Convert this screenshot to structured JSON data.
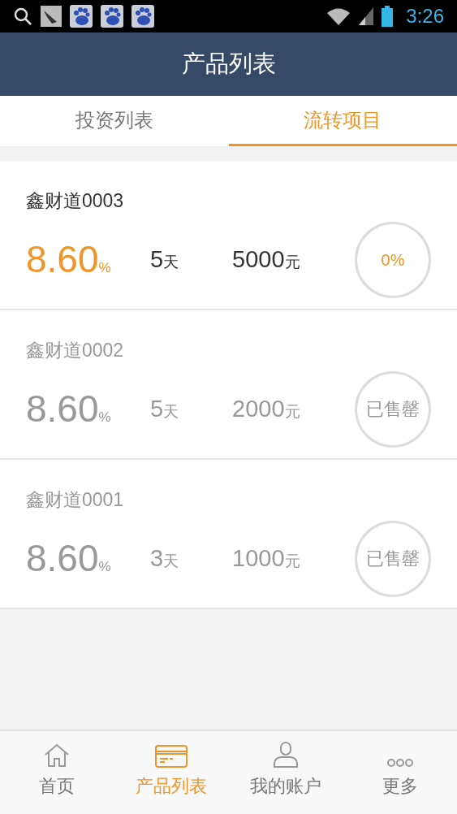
{
  "status_bar": {
    "time": "3:26"
  },
  "header": {
    "title": "产品列表"
  },
  "tabs": [
    {
      "label": "投资列表",
      "selected": false
    },
    {
      "label": "流转项目",
      "selected": true
    }
  ],
  "products": [
    {
      "name": "鑫财道0003",
      "rate": "8.60",
      "rate_unit": "%",
      "days": "5",
      "days_unit": "天",
      "amount": "5000",
      "amount_unit": "元",
      "badge": "0%",
      "sold_out": false
    },
    {
      "name": "鑫财道0002",
      "rate": "8.60",
      "rate_unit": "%",
      "days": "5",
      "days_unit": "天",
      "amount": "2000",
      "amount_unit": "元",
      "badge": "已售罄",
      "sold_out": true
    },
    {
      "name": "鑫财道0001",
      "rate": "8.60",
      "rate_unit": "%",
      "days": "3",
      "days_unit": "天",
      "amount": "1000",
      "amount_unit": "元",
      "badge": "已售罄",
      "sold_out": true
    }
  ],
  "bottom_nav": [
    {
      "label": "首页",
      "kind": "home",
      "selected": false
    },
    {
      "label": "产品列表",
      "kind": "card",
      "selected": true
    },
    {
      "label": "我的账户",
      "kind": "user",
      "selected": false
    },
    {
      "label": "更多",
      "kind": "more",
      "selected": false
    }
  ]
}
